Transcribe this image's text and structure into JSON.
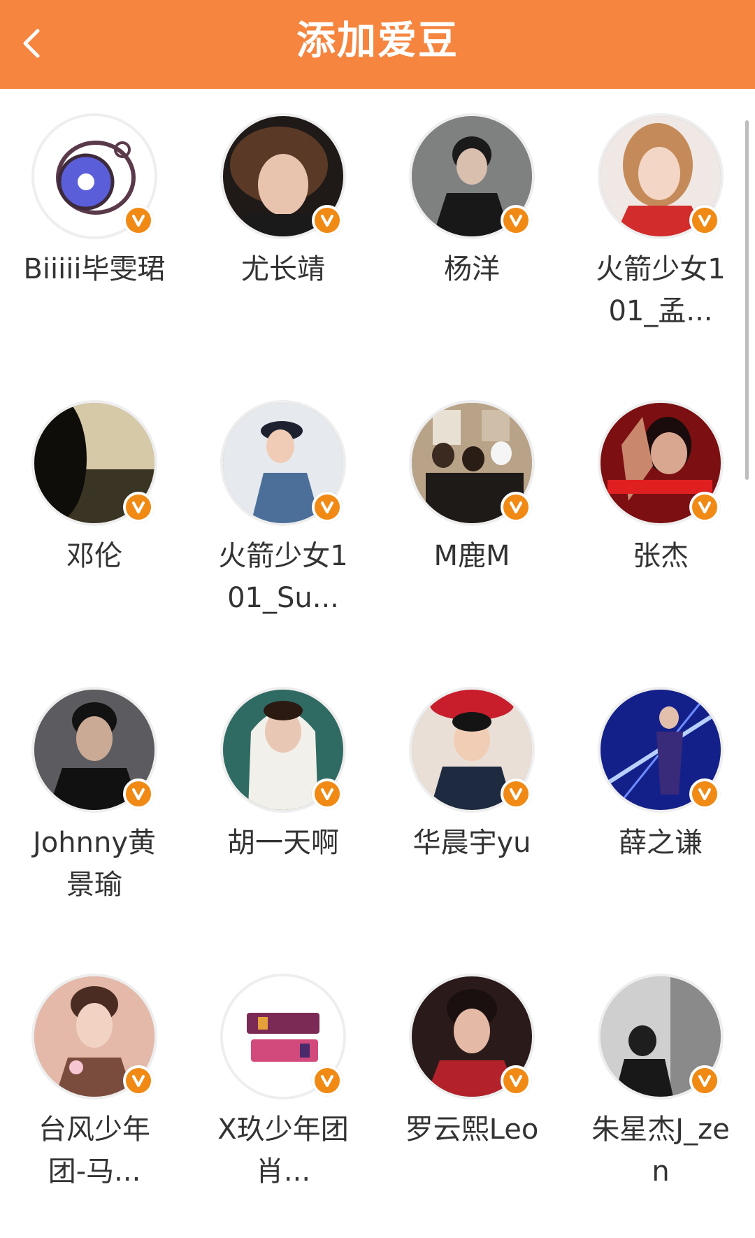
{
  "header": {
    "title": "添加爱豆",
    "bg_color": "#f5853f"
  },
  "badge_color": "#f08a15",
  "idols": [
    {
      "name": "Biiiii毕雯珺"
    },
    {
      "name": "尤长靖"
    },
    {
      "name": "杨洋"
    },
    {
      "name": "火箭少女101_孟..."
    },
    {
      "name": "邓伦"
    },
    {
      "name": "火箭少女101_Su..."
    },
    {
      "name": "M鹿M"
    },
    {
      "name": "张杰"
    },
    {
      "name": "Johnny黄景瑜"
    },
    {
      "name": "胡一天啊"
    },
    {
      "name": "华晨宇yu"
    },
    {
      "name": "薛之谦"
    },
    {
      "name": "台风少年团-马..."
    },
    {
      "name": "X玖少年团肖..."
    },
    {
      "name": "罗云熙Leo"
    },
    {
      "name": "朱星杰J_zen"
    }
  ]
}
